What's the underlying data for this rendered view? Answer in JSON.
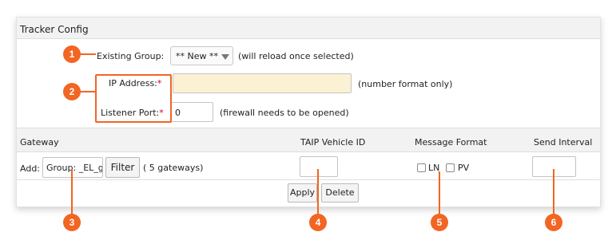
{
  "panel": {
    "title": "Tracker Config"
  },
  "form": {
    "existing_group_label": "Existing Group:",
    "existing_group_value": "** New **",
    "existing_group_hint": "(will reload once selected)",
    "ip_label": "IP Address:",
    "ip_value": "",
    "ip_hint": "(number format only)",
    "port_label": "Listener Port:",
    "port_value": "0",
    "port_hint": "(firewall needs to be opened)",
    "required_mark": "*"
  },
  "table": {
    "headers": [
      "Gateway",
      "TAIP Vehicle ID",
      "Message Format",
      "Send Interval"
    ],
    "add_label": "Add:",
    "gateway_value": "Group: _EL_g",
    "filter_label": "Filter",
    "gateway_count": "( 5 gateways)",
    "taip_value": "",
    "format_options": [
      "LN",
      "PV"
    ],
    "send_interval_value": ""
  },
  "actions": {
    "apply_label": "Apply",
    "delete_label": "Delete"
  },
  "callouts": [
    "1",
    "2",
    "3",
    "4",
    "5",
    "6"
  ],
  "colors": {
    "accent": "#f26522",
    "ip_field_bg": "#fbf2d4",
    "required": "#d0021b",
    "header_bg": "#f2f2f2"
  }
}
